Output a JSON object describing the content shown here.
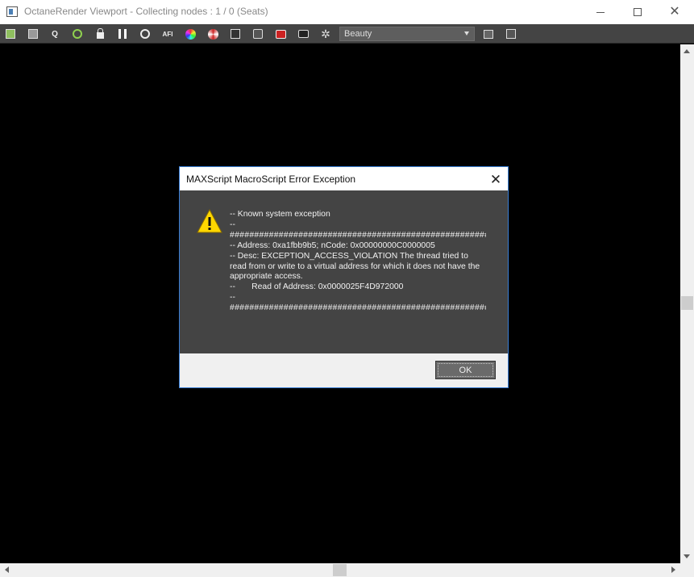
{
  "window": {
    "title": "OctaneRender Viewport - Collecting nodes : 1 / 0 (Seats)"
  },
  "toolbar": {
    "icons": [
      "export-icon",
      "clipboard-icon",
      "region-icon",
      "restart-icon",
      "lock-icon",
      "pause-icon",
      "refresh-icon",
      "afi-icon",
      "color-picker-icon",
      "render-settings-icon",
      "save-image-icon",
      "film-icon",
      "render-icon",
      "camera-icon",
      "settings-gear-icon",
      "list-icon",
      "image-icon"
    ],
    "afi_label": "AFI",
    "region_label": "Q",
    "pass_select": "Beauty"
  },
  "dialog": {
    "title": "MAXScript MacroScript Error Exception",
    "lines": {
      "l1": "-- Known system exception",
      "l2": "--",
      "l3": "########################################################################",
      "l4": "-- Address: 0xa1fbb9b5; nCode: 0x00000000C0000005",
      "l5": "-- Desc: EXCEPTION_ACCESS_VIOLATION The thread tried to read from or write to a virtual address for which it does not have the appropriate access.",
      "l6": "--       Read of Address: 0x0000025F4D972000",
      "l7": "--",
      "l8": "########################################################################"
    },
    "ok_label": "OK"
  },
  "colors": {
    "toolbar_bg": "#444444",
    "dialog_body_bg": "#444444",
    "dialog_border": "#3a7fd6",
    "warning_yellow": "#ffd700",
    "viewport_bg": "#000000"
  }
}
